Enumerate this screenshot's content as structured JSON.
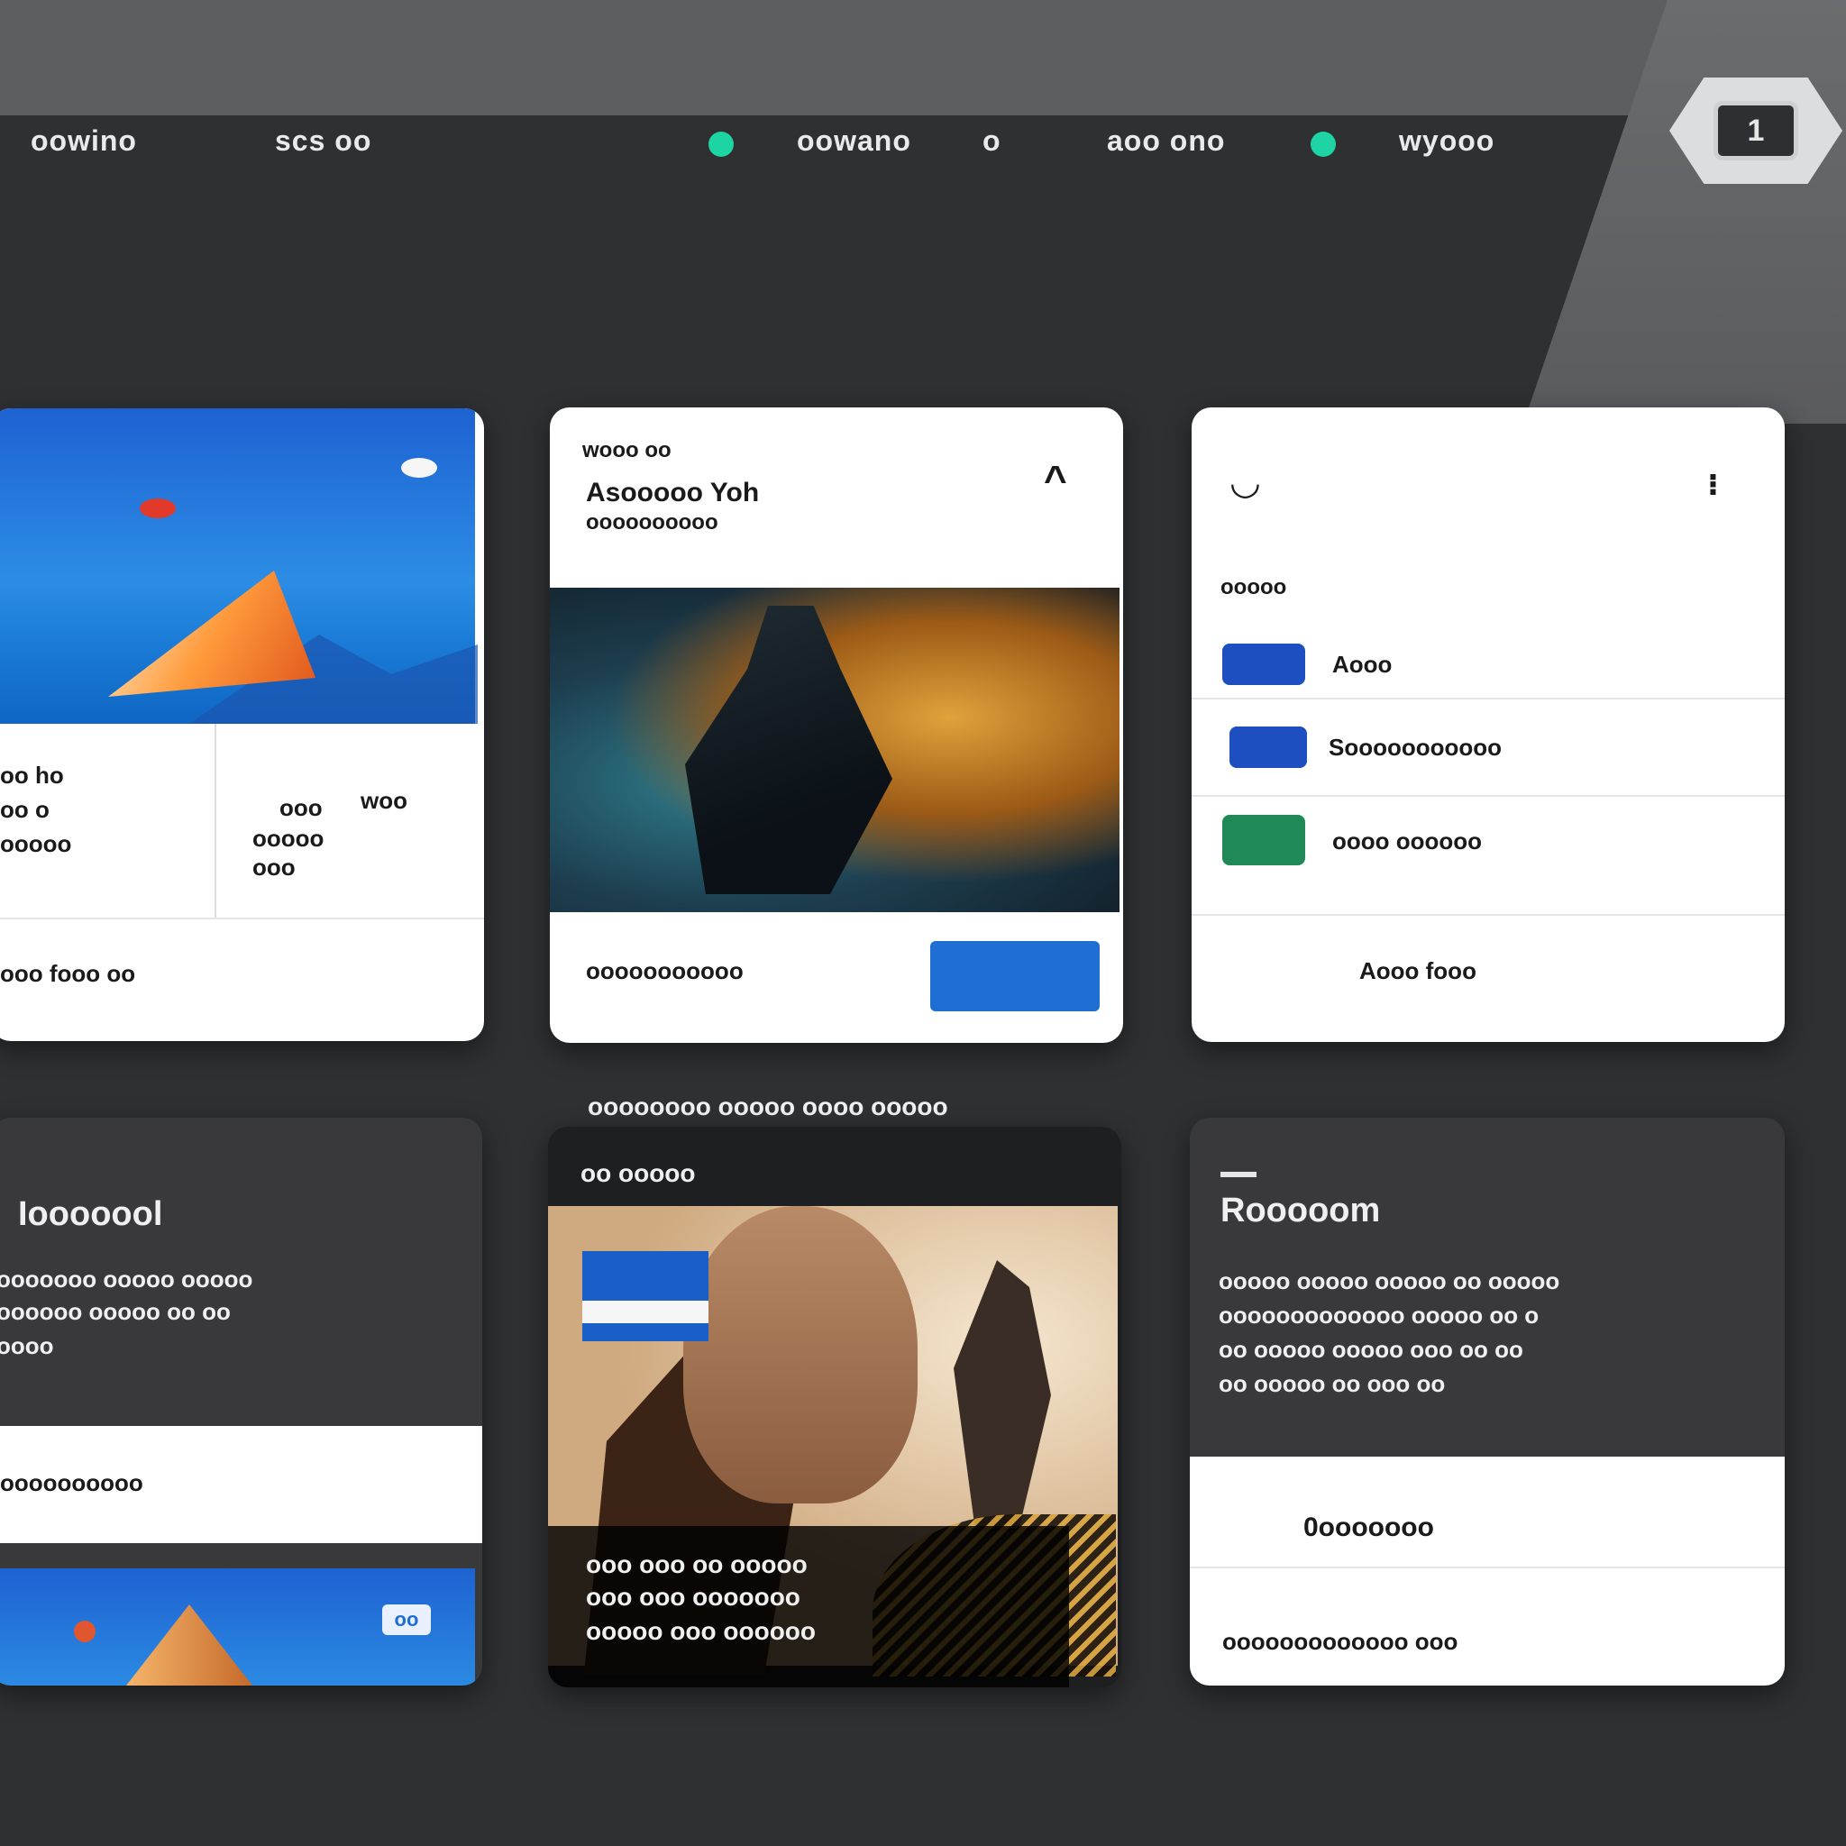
{
  "nav": {
    "items": [
      "oowino",
      "scs oo",
      "oowano",
      "o",
      "aoo ono",
      "wyooo"
    ]
  },
  "logo": {
    "glyph": "1"
  },
  "cards": {
    "a": {
      "left_lines": [
        "oo ho",
        "oo o",
        "ooooo"
      ],
      "right_top": "woo",
      "right_lines": [
        "ooo",
        "ooooo",
        "ooo"
      ],
      "footer": "ooo fooo oo"
    },
    "b": {
      "kicker": "wooo oo",
      "title": "Asooooo Yoh",
      "subtitle": "oooooooooo",
      "chevron": "^",
      "footer": "ooooooooooo",
      "button": ""
    },
    "c": {
      "section": "ooooo",
      "items": [
        "Aooo",
        "Sooooooooooo",
        "oooo oooooo"
      ],
      "footer": "Aooo fooo",
      "icons": [
        "#1d4fc0",
        "#1d4fc0",
        "#1f8a58"
      ]
    },
    "d": {
      "title": "Iooooool",
      "lines": [
        "ooooooo ooooo ooooo",
        "oooooo ooooo oo oo",
        "oooo"
      ],
      "footer": "oooooooooo",
      "mini_button": "oo"
    },
    "e": {
      "heading_above": "oooooooo ooooo oooo ooooo",
      "kicker": "oo ooooo",
      "caption_lines": [
        "ooo ooo oo ooooo",
        "ooo ooo ooooooo",
        "ooooo  ooo oooooo"
      ]
    },
    "f": {
      "title": "Rooooom",
      "lines": [
        "ooooo ooooo ooooo oo ooooo",
        "ooooooooooooo ooooo oo o",
        "oo ooooo ooooo ooo oo oo",
        "oo ooooo oo ooo oo"
      ],
      "mid": "0ooooooo",
      "footer": "ooooooooooooo ooo"
    }
  },
  "colors": {
    "accent": "#1ed3a4",
    "blue": "#1f6ed4",
    "green": "#1f8a58",
    "bg": "#2f3032"
  }
}
